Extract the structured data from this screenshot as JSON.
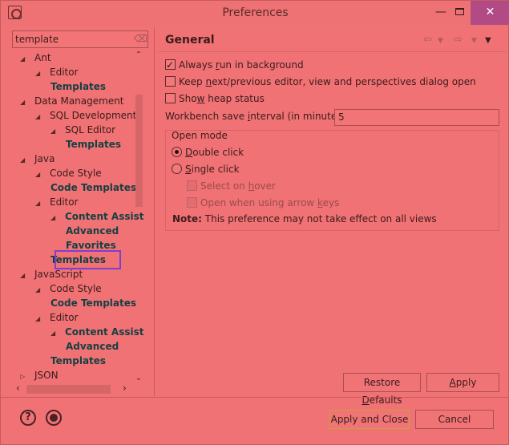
{
  "window": {
    "title": "Preferences",
    "minimize": "—",
    "close": "✕"
  },
  "filter": {
    "value": "template"
  },
  "tree": [
    {
      "label": "Ant",
      "indent": 0,
      "bold": false,
      "twisty": "◢"
    },
    {
      "label": "Editor",
      "indent": 1,
      "bold": false,
      "twisty": "◢"
    },
    {
      "label": "Templates",
      "indent": 2,
      "bold": true,
      "twisty": ""
    },
    {
      "label": "Data Management",
      "indent": 0,
      "bold": false,
      "twisty": "◢"
    },
    {
      "label": "SQL Development",
      "indent": 1,
      "bold": false,
      "twisty": "◢"
    },
    {
      "label": "SQL Editor",
      "indent": 2,
      "bold": false,
      "twisty": "◢"
    },
    {
      "label": "Templates",
      "indent": 3,
      "bold": true,
      "twisty": ""
    },
    {
      "label": "Java",
      "indent": 0,
      "bold": false,
      "twisty": "◢"
    },
    {
      "label": "Code Style",
      "indent": 1,
      "bold": false,
      "twisty": "◢"
    },
    {
      "label": "Code Templates",
      "indent": 2,
      "bold": true,
      "twisty": ""
    },
    {
      "label": "Editor",
      "indent": 1,
      "bold": false,
      "twisty": "◢"
    },
    {
      "label": "Content Assist",
      "indent": 2,
      "bold": true,
      "twisty": "◢"
    },
    {
      "label": "Advanced",
      "indent": 3,
      "bold": true,
      "twisty": ""
    },
    {
      "label": "Favorites",
      "indent": 3,
      "bold": true,
      "twisty": ""
    },
    {
      "label": "Templates",
      "indent": 2,
      "bold": true,
      "twisty": ""
    },
    {
      "label": "JavaScript",
      "indent": 0,
      "bold": false,
      "twisty": "◢"
    },
    {
      "label": "Code Style",
      "indent": 1,
      "bold": false,
      "twisty": "◢"
    },
    {
      "label": "Code Templates",
      "indent": 2,
      "bold": true,
      "twisty": ""
    },
    {
      "label": "Editor",
      "indent": 1,
      "bold": false,
      "twisty": "◢"
    },
    {
      "label": "Content Assist",
      "indent": 2,
      "bold": true,
      "twisty": "◢"
    },
    {
      "label": "Advanced",
      "indent": 3,
      "bold": true,
      "twisty": ""
    },
    {
      "label": "Templates",
      "indent": 2,
      "bold": true,
      "twisty": ""
    },
    {
      "label": "JSON",
      "indent": 0,
      "bold": false,
      "twisty": "▷"
    }
  ],
  "page": {
    "title": "General",
    "always_run": {
      "pre": "Always ",
      "u": "r",
      "post": "un in background",
      "checked": true
    },
    "keep_next": {
      "pre": "Keep ",
      "u": "n",
      "post": "ext/previous editor, view and perspectives dialog open",
      "checked": false
    },
    "show_heap": {
      "pre": "Sho",
      "u": "w",
      "post": " heap status",
      "checked": false
    },
    "interval": {
      "pre": "Workbench save ",
      "u": "i",
      "post": "nterval (in minutes):",
      "value": "5"
    },
    "open_mode": {
      "title": "Open mode",
      "double": {
        "u": "D",
        "post": "ouble click",
        "selected": true
      },
      "single": {
        "u": "S",
        "post": "ingle click",
        "selected": false
      },
      "hover": {
        "pre": "Select on ",
        "u": "h",
        "post": "over"
      },
      "arrow": {
        "pre": "Open when using arrow ",
        "u": "k",
        "post": "eys"
      }
    },
    "note": {
      "bold": "Note:",
      "text": " This preference may not take effect on all views"
    }
  },
  "buttons": {
    "restore": {
      "pre": "Restore ",
      "u": "D",
      "post": "efaults"
    },
    "apply": {
      "u": "A",
      "post": "pply"
    },
    "apply_close": "Apply and Close",
    "cancel": "Cancel"
  }
}
